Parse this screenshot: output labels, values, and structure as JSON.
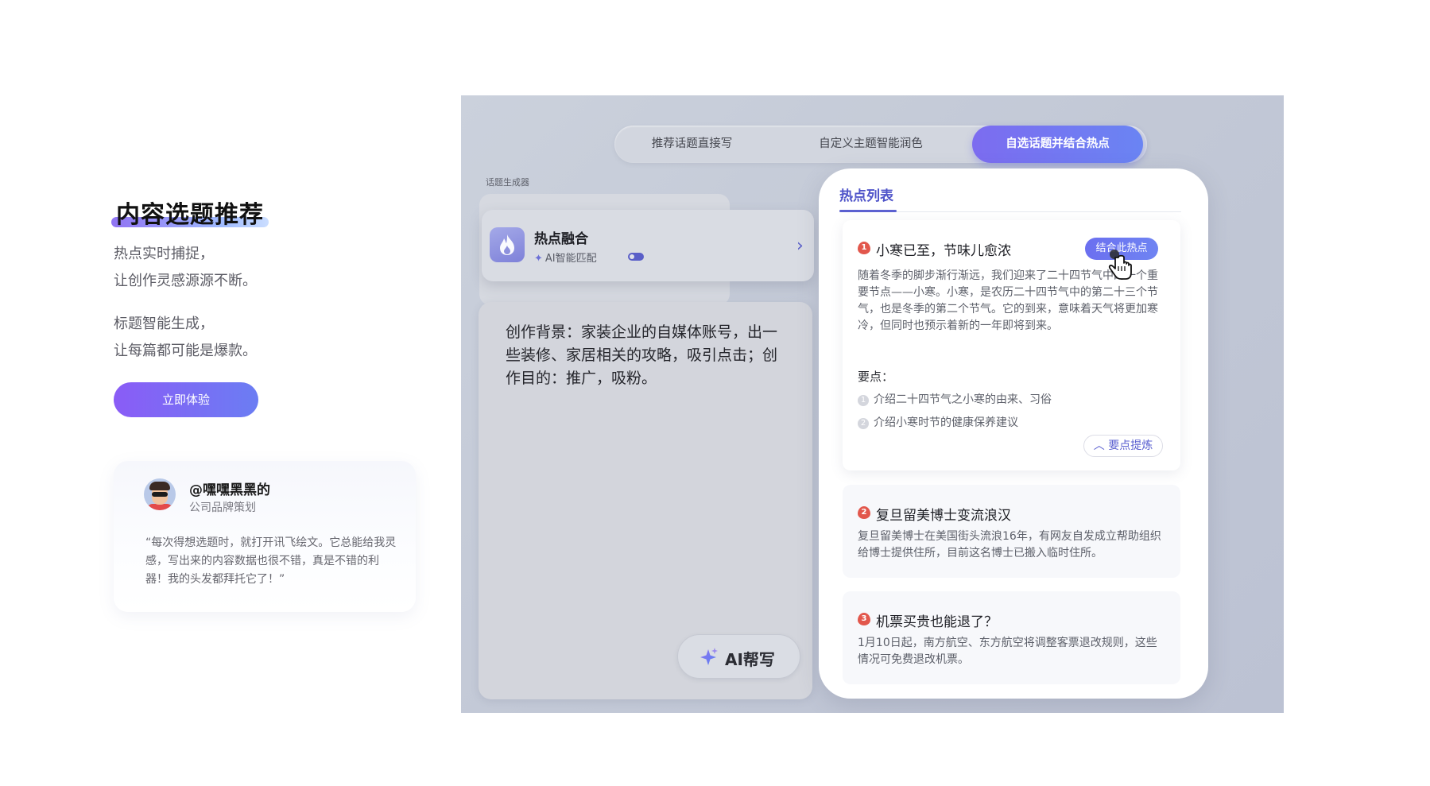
{
  "hero": {
    "title": "内容选题推荐",
    "para1_line1": "热点实时捕捉，",
    "para1_line2": "让创作灵感源源不断。",
    "para2_line1": "标题智能生成，",
    "para2_line2": "让每篇都可能是爆款。",
    "cta_label": "立即体验"
  },
  "testimonial": {
    "name": "@嘿嘿黑黑的",
    "role": "公司品牌策划",
    "quote": "“每次得想选题时，就打开讯飞绘文。它总能给我灵感，写出来的内容数据也很不错，真是不错的利器！我的头发都拜托它了！”"
  },
  "product": {
    "tabs": [
      "推荐话题直接写",
      "自定义主题智能润色",
      "自选话题并结合热点"
    ],
    "active_tab": 2,
    "generator_label": "话题生成器",
    "hot_fusion": {
      "title": "热点融合",
      "subtitle": "AI智能匹配",
      "icon": "flame-icon"
    },
    "background_text": "创作背景：家装企业的自媒体账号，出一些装修、家居相关的攻略，吸引点击；创作目的：推广，吸粉。",
    "ai_write_label": "AI帮写",
    "hot_list": {
      "tab_label": "热点列表",
      "items": [
        {
          "rank": "1",
          "title": "小寒已至，节味儿愈浓",
          "body": "随着冬季的脚步渐行渐远，我们迎来了二十四节气中的一个重要节点——小寒。小寒，是农历二十四节气中的第二十三个节气，也是冬季的第二个节气。它的到来，意味着天气将更加寒冷，但同时也预示着新的一年即将到来。",
          "action_label": "结合此热点",
          "key_points_label": "要点：",
          "key_points": [
            {
              "num": "1",
              "text": "介绍二十四节气之小寒的由来、习俗"
            },
            {
              "num": "2",
              "text": "介绍小寒时节的健康保养建议"
            }
          ],
          "refine_label": "要点提炼"
        },
        {
          "rank": "2",
          "title": "复旦留美博士变流浪汉",
          "body": "复旦留美博士在美国街头流浪16年，有网友自发成立帮助组织给博士提供住所，目前这名博士已搬入临时住所。"
        },
        {
          "rank": "3",
          "title": "机票买贵也能退了？",
          "body": "1月10日起，南方航空、东方航空将调整客票退改规则，这些情况可免费退改机票。"
        }
      ]
    }
  },
  "colors": {
    "accent": "#6a6ff0",
    "cta_gradient_start": "#8a5cf6",
    "cta_gradient_end": "#6b7df3",
    "rank_red": "#e2574c",
    "panel_bg": "#c4cad8"
  }
}
